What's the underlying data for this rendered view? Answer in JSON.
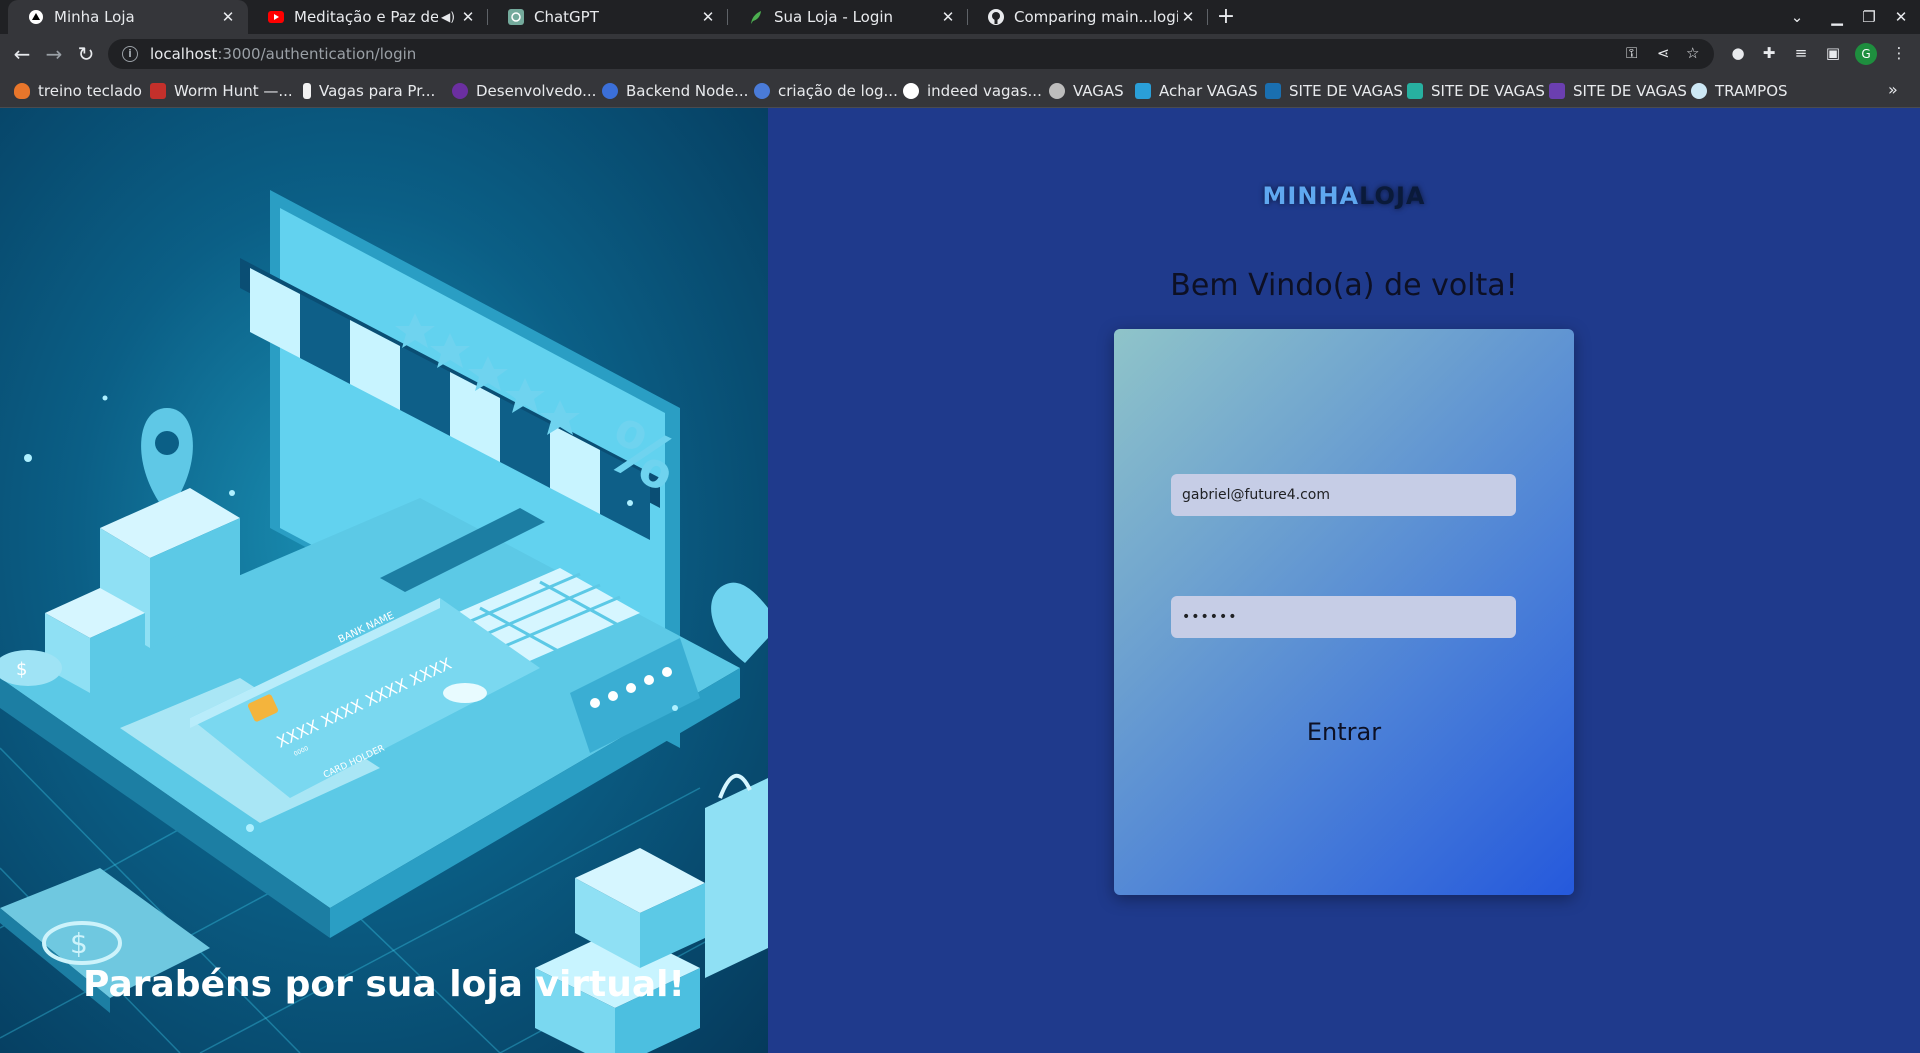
{
  "browser": {
    "tabs": [
      {
        "title": "Minha Loja",
        "icon": "triangle-icon",
        "active": true
      },
      {
        "title": "Meditação e Paz de Es",
        "icon": "youtube-icon",
        "active": false,
        "muted_icon": "speaker-icon"
      },
      {
        "title": "ChatGPT",
        "icon": "chatgpt-icon",
        "active": false
      },
      {
        "title": "Sua Loja - Login",
        "icon": "leaf-icon",
        "active": false
      },
      {
        "title": "Comparing main...login · F",
        "icon": "github-icon",
        "active": false
      }
    ],
    "close_glyph": "✕",
    "new_tab_glyph": "+",
    "url_host": "localhost",
    "url_path": ":3000/authentication/login",
    "profile_initial": "G",
    "bookmarks": [
      {
        "label": "treino teclado",
        "color": "#e8762b"
      },
      {
        "label": "Worm Hunt —...",
        "color": "#c4302b"
      },
      {
        "label": "Vagas para Pr...",
        "color": "#f2f2f2"
      },
      {
        "label": "Desenvolvedo...",
        "color": "#6b2fa0"
      },
      {
        "label": "Backend Node...",
        "color": "#3b6fd8"
      },
      {
        "label": "criação de log...",
        "color": "#4a7bd8"
      },
      {
        "label": "indeed vagas...",
        "color": "#ffffff"
      },
      {
        "label": "VAGAS",
        "color": "#bdbdbd"
      },
      {
        "label": "Achar VAGAS",
        "color": "#2a9fd8"
      },
      {
        "label": "SITE DE VAGAS",
        "color": "#1a6fb0"
      },
      {
        "label": "SITE DE VAGAS",
        "color": "#27b0a0"
      },
      {
        "label": "SITE DE VAGAS",
        "color": "#6b3fb0"
      },
      {
        "label": "TRAMPOS",
        "color": "#cde8f5"
      }
    ]
  },
  "left": {
    "congrats": "Parabéns por sua loja virtual!",
    "illustration": "online-shop-laptop-credit-card-illustration",
    "card_number": "XXXX XXXX XXXX XXXX",
    "card_bank": "BANK NAME",
    "card_holder": "CARD HOLDER",
    "card_small": "0000"
  },
  "right": {
    "logo_part1": "MINHA",
    "logo_part2": "LOJA",
    "welcome": "Bem Vindo(a) de volta!",
    "email_value": "gabriel@future4.com",
    "password_value": "••••••",
    "submit_label": "Entrar"
  },
  "colors": {
    "accent": "#1f3a8c",
    "card_gradient_start": "#8fc4c9",
    "card_gradient_end": "#2559dc"
  }
}
